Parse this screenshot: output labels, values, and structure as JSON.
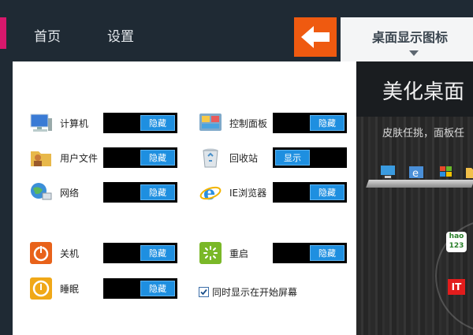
{
  "nav": {
    "home": "首页",
    "settings": "设置"
  },
  "tab": {
    "active_label": "桌面显示图标"
  },
  "items": {
    "computer": {
      "label": "计算机",
      "state": "隐藏"
    },
    "control_panel": {
      "label": "控制面板",
      "state": "隐藏"
    },
    "user_files": {
      "label": "用户文件",
      "state": "隐藏"
    },
    "recycle_bin": {
      "label": "回收站",
      "state": "显示"
    },
    "network": {
      "label": "网络",
      "state": "隐藏"
    },
    "ie": {
      "label": "IE浏览器",
      "state": "隐藏"
    },
    "shutdown": {
      "label": "关机",
      "state": "隐藏"
    },
    "restart": {
      "label": "重启",
      "state": "隐藏"
    },
    "sleep": {
      "label": "睡眠",
      "state": "隐藏"
    }
  },
  "checkbox": {
    "label": "同时显示在开始屏幕",
    "checked": true
  },
  "preview": {
    "title": "美化桌面",
    "subtitle": "皮肤任挑，面板任",
    "hao_line1": "hao",
    "hao_line2": "123",
    "it": "IT"
  },
  "colors": {
    "accent": "#d8186c",
    "back": "#ef5a10",
    "toggle_on": "#1e8fe0"
  }
}
